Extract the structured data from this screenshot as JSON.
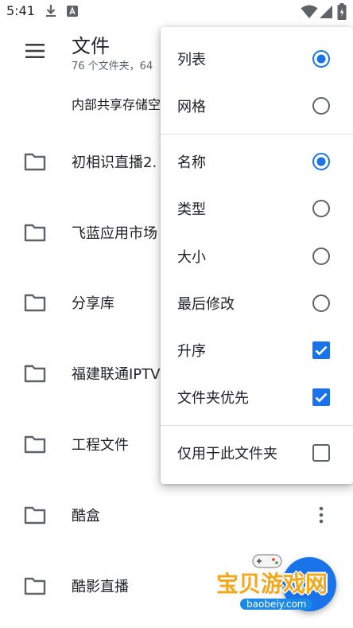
{
  "status_bar": {
    "time": "5:41",
    "icons": [
      "download-icon",
      "a-letter-icon",
      "wifi-icon",
      "signal-icon",
      "battery-icon"
    ]
  },
  "app_bar": {
    "title": "文件",
    "subtitle": "76 个文件夹，64"
  },
  "storage_label": "内部共享存储空",
  "folders": [
    {
      "name": "初相识直播2."
    },
    {
      "name": "飞蓝应用市场"
    },
    {
      "name": "分享库"
    },
    {
      "name": "福建联通IPTV"
    },
    {
      "name": "工程文件"
    },
    {
      "name": "酷盒"
    },
    {
      "name": "酷影直播"
    }
  ],
  "menu": {
    "view_modes": [
      {
        "label": "列表",
        "selected": true
      },
      {
        "label": "网格",
        "selected": false
      }
    ],
    "sort_by": [
      {
        "label": "名称",
        "selected": true
      },
      {
        "label": "类型",
        "selected": false
      },
      {
        "label": "大小",
        "selected": false
      },
      {
        "label": "最后修改",
        "selected": false
      }
    ],
    "options": [
      {
        "label": "升序",
        "checked": true
      },
      {
        "label": "文件夹优先",
        "checked": true
      }
    ],
    "scope": {
      "label": "仅用于此文件夹",
      "checked": false
    }
  },
  "watermark": {
    "text": "宝贝游戏网",
    "url": "baobeiy.com"
  },
  "colors": {
    "accent": "#1a73e8",
    "icon": "#5f6368",
    "text": "#202124"
  }
}
